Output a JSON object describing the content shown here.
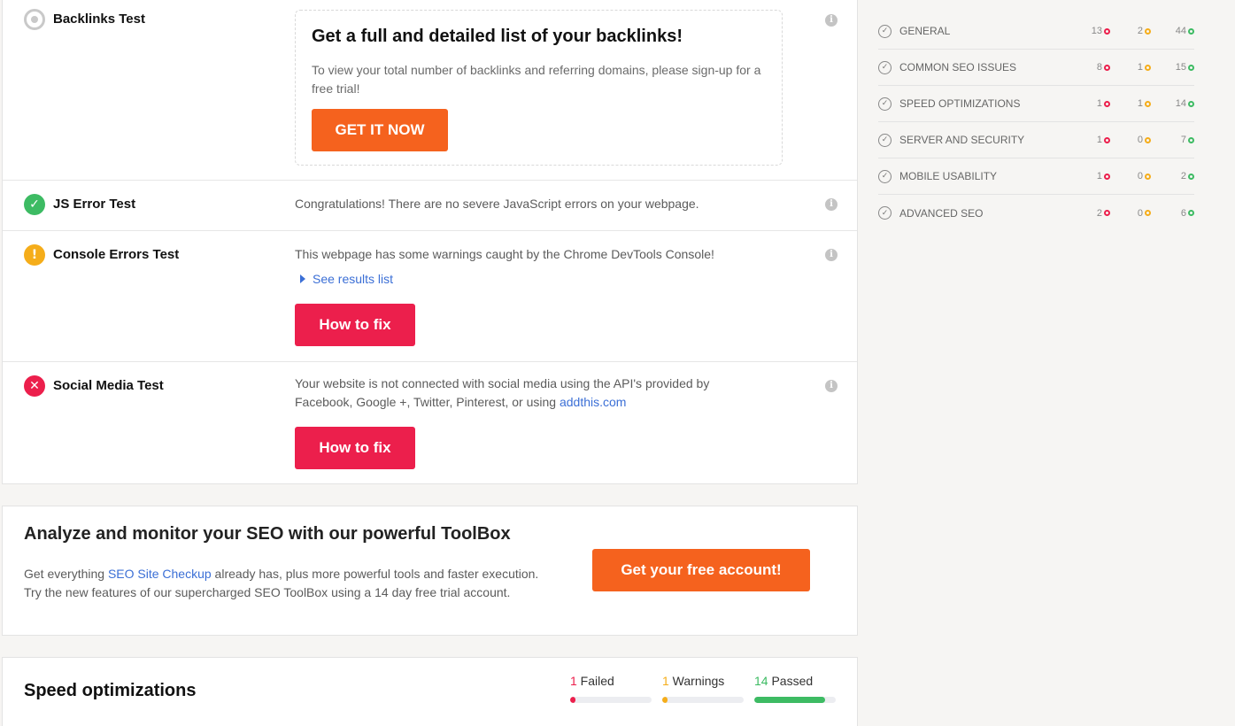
{
  "tests": {
    "backlinks": {
      "name": "Backlinks Test",
      "promo_title": "Get a full and detailed list of your backlinks!",
      "promo_text": "To view your total number of backlinks and referring domains, please sign-up for a free trial!",
      "cta": "GET IT NOW"
    },
    "js_error": {
      "name": "JS Error Test",
      "message": "Congratulations! There are no severe JavaScript errors on your webpage."
    },
    "console_errors": {
      "name": "Console Errors Test",
      "message": "This webpage has some warnings caught by the Chrome DevTools Console!",
      "see_results": "See results list",
      "fix": "How to fix"
    },
    "social_media": {
      "name": "Social Media Test",
      "message_part1": "Your website is not connected with social media using the API's provided by Facebook, Google +, Twitter, Pinterest, or using ",
      "message_link": "addthis.com",
      "fix": "How to fix"
    },
    "info_icon": "i"
  },
  "toolbox": {
    "title": "Analyze and monitor your SEO with our powerful ToolBox",
    "text_part1": "Get everything ",
    "text_link": "SEO Site Checkup",
    "text_part2": " already has, plus more powerful tools and faster execution. Try the new features of our supercharged SEO ToolBox using a 14 day free trial account.",
    "cta": "Get your free account!"
  },
  "speed": {
    "title": "Speed optimizations",
    "failed": {
      "count": "1",
      "label": " Failed",
      "fraction": 0.07
    },
    "warnings": {
      "count": "1",
      "label": " Warnings",
      "fraction": 0.07
    },
    "passed": {
      "count": "14",
      "label": " Passed",
      "fraction": 0.87
    }
  },
  "sidebar": {
    "items": [
      {
        "label": "GENERAL",
        "failed": "13",
        "warnings": "2",
        "passed": "44"
      },
      {
        "label": "COMMON SEO ISSUES",
        "failed": "8",
        "warnings": "1",
        "passed": "15"
      },
      {
        "label": "SPEED OPTIMIZATIONS",
        "failed": "1",
        "warnings": "1",
        "passed": "14"
      },
      {
        "label": "SERVER AND SECURITY",
        "failed": "1",
        "warnings": "0",
        "passed": "7"
      },
      {
        "label": "MOBILE USABILITY",
        "failed": "1",
        "warnings": "0",
        "passed": "2"
      },
      {
        "label": "ADVANCED SEO",
        "failed": "2",
        "warnings": "0",
        "passed": "6"
      }
    ]
  },
  "colors": {
    "fail": "#ec1f4c",
    "warn": "#f5ad1a",
    "pass": "#3dbb63",
    "cta_orange": "#f5621e",
    "link": "#3b6fd6"
  }
}
